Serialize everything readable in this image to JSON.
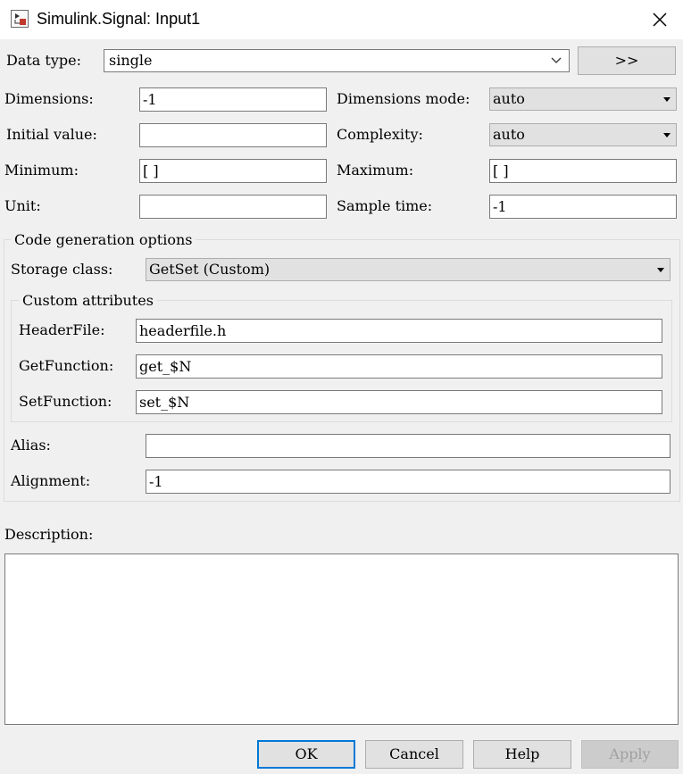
{
  "window": {
    "title": "Simulink.Signal: Input1",
    "icon": "simulink-model-icon",
    "close_icon": "close-icon"
  },
  "data_type": {
    "label": "Data type:",
    "value": "single",
    "expand_label": ">>"
  },
  "dimensions": {
    "label": "Dimensions:",
    "value": "-1"
  },
  "dimensions_mode": {
    "label": "Dimensions mode:",
    "value": "auto"
  },
  "initial_value": {
    "label": "Initial value:",
    "value": ""
  },
  "complexity": {
    "label": "Complexity:",
    "value": "auto"
  },
  "minimum": {
    "label": "Minimum:",
    "value": "[ ]"
  },
  "maximum": {
    "label": "Maximum:",
    "value": "[ ]"
  },
  "unit": {
    "label": "Unit:",
    "value": ""
  },
  "sample_time": {
    "label": "Sample time:",
    "value": "-1"
  },
  "code_generation": {
    "title": "Code generation options",
    "storage_class": {
      "label": "Storage class:",
      "value": "GetSet (Custom)"
    },
    "custom_attributes": {
      "title": "Custom attributes",
      "header_file": {
        "label": "HeaderFile:",
        "value": "headerfile.h"
      },
      "get_function": {
        "label": "GetFunction:",
        "value": "get_$N"
      },
      "set_function": {
        "label": "SetFunction:",
        "value": "set_$N"
      }
    },
    "alias": {
      "label": "Alias:",
      "value": ""
    },
    "alignment": {
      "label": "Alignment:",
      "value": "-1"
    }
  },
  "description": {
    "label": "Description:",
    "value": ""
  },
  "buttons": {
    "ok": "OK",
    "cancel": "Cancel",
    "help": "Help",
    "apply": "Apply"
  },
  "colors": {
    "default_button_border": "#0078d7",
    "disabled_text": "#a0a0a0"
  }
}
